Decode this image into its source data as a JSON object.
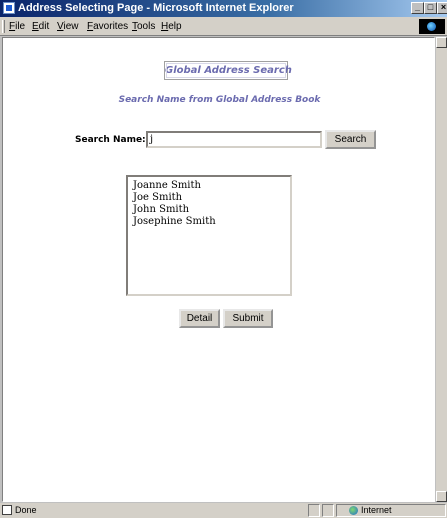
{
  "window": {
    "title": "Address Selecting Page - Microsoft Internet Explorer",
    "controls": {
      "minimize": "_",
      "maximize": "□",
      "close": "×"
    }
  },
  "menu": {
    "items": [
      "File",
      "Edit",
      "View",
      "Favorites",
      "Tools",
      "Help"
    ]
  },
  "page": {
    "heading": "Global Address Search",
    "subheading": "Search Name from Global Address Book",
    "search_label": "Search Name:",
    "search_value": "j",
    "search_button": "Search",
    "results": [
      "Joanne Smith",
      "Joe Smith",
      "John Smith",
      "Josephine Smith"
    ],
    "detail_button": "Detail",
    "submit_button": "Submit"
  },
  "status": {
    "text": "Done",
    "zone": "Internet"
  },
  "colors": {
    "heading": "#6b6baf",
    "titlebar_start": "#0a246a",
    "titlebar_end": "#a6caf0",
    "chrome": "#d4d0c8"
  }
}
